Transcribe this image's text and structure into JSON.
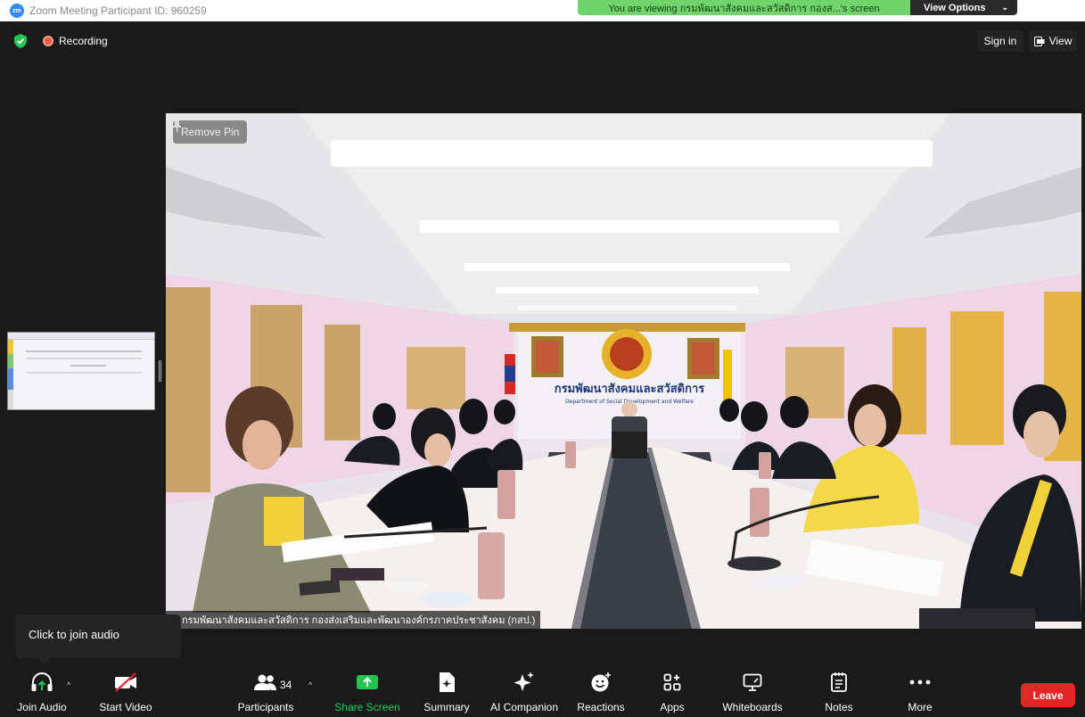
{
  "titlebar": {
    "logo": "zm",
    "title": "Zoom Meeting Participant ID: 960259",
    "banner": "You are viewing กรมพัฒนาสังคมและสวัสดิการ กองส...'s screen",
    "view_options": "View Options"
  },
  "meeting": {
    "recording_label": "Recording",
    "sign_in": "Sign in",
    "view": "View",
    "remove_pin": "Remove Pin",
    "caption": "กรมพัฒนาสังคมและสวัสดิการ กองส่งเสริมและพัฒนาองค์กรภาคประชาสังคม (กสป.)",
    "sign_thai": "กรมพัฒนาสังคมและสวัสดิการ",
    "sign_english": "Department of Social Development and Welfare"
  },
  "tooltip": "Click to join audio",
  "toolbar": {
    "join_audio": "Join Audio",
    "start_video": "Start Video",
    "participants": "Participants",
    "participant_count": "34",
    "share_screen": "Share Screen",
    "summary": "Summary",
    "ai_companion": "AI Companion",
    "reactions": "Reactions",
    "apps": "Apps",
    "whiteboards": "Whiteboards",
    "notes": "Notes",
    "more": "More",
    "leave": "Leave"
  },
  "colors": {
    "share_green": "#6fd46a",
    "leave_red": "#e02828",
    "security_green": "#23c552",
    "zoom_blue": "#2d8cff"
  },
  "icons": [
    "zoom-logo-icon",
    "shield-check-icon",
    "recording-dot-icon",
    "view-icon",
    "pin-icon",
    "headphones-icon",
    "video-off-icon",
    "participants-icon",
    "share-arrow-icon",
    "summary-icon",
    "sparkle-icon",
    "smiley-plus-icon",
    "apps-icon",
    "whiteboard-icon",
    "notes-icon",
    "more-dots-icon",
    "chevron-up-icon"
  ]
}
